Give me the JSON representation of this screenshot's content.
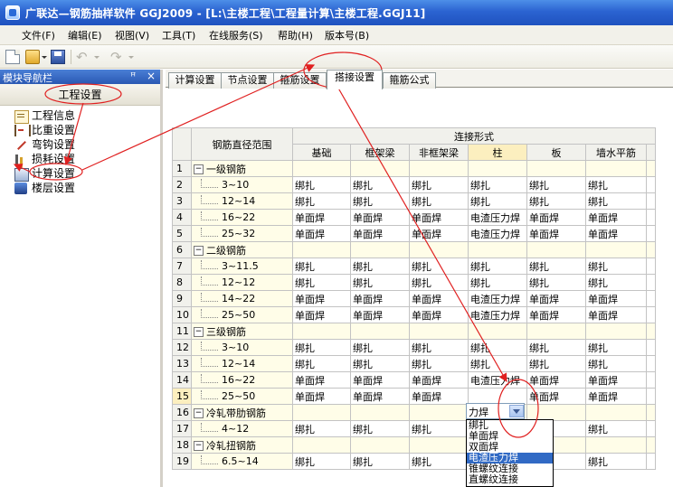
{
  "window": {
    "title": "广联达—钢筋抽样软件 GGJ2009 - [L:\\主楼工程\\工程量计算\\主楼工程.GGJ11]"
  },
  "menu": [
    {
      "label": "文件(F)"
    },
    {
      "label": "编辑(E)"
    },
    {
      "label": "视图(V)"
    },
    {
      "label": "工具(T)"
    },
    {
      "label": "在线服务(S)"
    },
    {
      "label": "帮助(H)"
    },
    {
      "label": "版本号(B)"
    }
  ],
  "toolbar": {
    "undo_glyph": "↶",
    "redo_glyph": "↷",
    "icons": [
      "new-file-icon",
      "open-folder-icon",
      "save-icon",
      "undo-icon",
      "redo-icon"
    ]
  },
  "nav_panel": {
    "title": "模块导航栏",
    "pin_glyph": "ꟸ",
    "close_glyph": "×",
    "section_button": "工程设置",
    "items": [
      {
        "label": "工程信息",
        "icon": "info-icon"
      },
      {
        "label": "比重设置",
        "icon": "weight-icon"
      },
      {
        "label": "弯钩设置",
        "icon": "hook-icon"
      },
      {
        "label": "损耗设置",
        "icon": "loss-icon"
      },
      {
        "label": "计算设置",
        "icon": "calc-icon"
      },
      {
        "label": "楼层设置",
        "icon": "floor-icon"
      }
    ]
  },
  "tabs": [
    {
      "label": "计算设置"
    },
    {
      "label": "节点设置"
    },
    {
      "label": "箍筋设置"
    },
    {
      "label": "搭接设置",
      "active": true
    },
    {
      "label": "箍筋公式"
    }
  ],
  "grid": {
    "range_header": "钢筋直径范围",
    "connection_header": "连接形式",
    "columns": [
      "基础",
      "框架梁",
      "非框架梁",
      "柱",
      "板",
      "墙水平筋"
    ],
    "rows": [
      {
        "num": "1",
        "group": true,
        "name": "一级钢筋",
        "cells": [
          "",
          "",
          "",
          "",
          "",
          ""
        ]
      },
      {
        "num": "2",
        "name": "3~10",
        "cells": [
          "绑扎",
          "绑扎",
          "绑扎",
          "绑扎",
          "绑扎",
          "绑扎"
        ]
      },
      {
        "num": "3",
        "name": "12~14",
        "cells": [
          "绑扎",
          "绑扎",
          "绑扎",
          "绑扎",
          "绑扎",
          "绑扎"
        ]
      },
      {
        "num": "4",
        "name": "16~22",
        "cells": [
          "单面焊",
          "单面焊",
          "单面焊",
          "电渣压力焊",
          "单面焊",
          "单面焊"
        ]
      },
      {
        "num": "5",
        "name": "25~32",
        "cells": [
          "单面焊",
          "单面焊",
          "单面焊",
          "电渣压力焊",
          "单面焊",
          "单面焊"
        ]
      },
      {
        "num": "6",
        "group": true,
        "name": "二级钢筋",
        "cells": [
          "",
          "",
          "",
          "",
          "",
          ""
        ]
      },
      {
        "num": "7",
        "name": "3~11.5",
        "cells": [
          "绑扎",
          "绑扎",
          "绑扎",
          "绑扎",
          "绑扎",
          "绑扎"
        ]
      },
      {
        "num": "8",
        "name": "12~12",
        "cells": [
          "绑扎",
          "绑扎",
          "绑扎",
          "绑扎",
          "绑扎",
          "绑扎"
        ]
      },
      {
        "num": "9",
        "name": "14~22",
        "cells": [
          "单面焊",
          "单面焊",
          "单面焊",
          "电渣压力焊",
          "单面焊",
          "单面焊"
        ]
      },
      {
        "num": "10",
        "name": "25~50",
        "cells": [
          "单面焊",
          "单面焊",
          "单面焊",
          "电渣压力焊",
          "单面焊",
          "单面焊"
        ]
      },
      {
        "num": "11",
        "group": true,
        "name": "三级钢筋",
        "cells": [
          "",
          "",
          "",
          "",
          "",
          ""
        ]
      },
      {
        "num": "12",
        "name": "3~10",
        "cells": [
          "绑扎",
          "绑扎",
          "绑扎",
          "绑扎",
          "绑扎",
          "绑扎"
        ]
      },
      {
        "num": "13",
        "name": "12~14",
        "cells": [
          "绑扎",
          "绑扎",
          "绑扎",
          "绑扎",
          "绑扎",
          "绑扎"
        ]
      },
      {
        "num": "14",
        "name": "16~22",
        "cells": [
          "单面焊",
          "单面焊",
          "单面焊",
          "电渣压力焊",
          "单面焊",
          "单面焊"
        ]
      },
      {
        "num": "15",
        "name": "25~50",
        "selected": true,
        "cells": [
          "单面焊",
          "单面焊",
          "单面焊",
          "",
          "单面焊",
          "单面焊"
        ]
      },
      {
        "num": "16",
        "group": true,
        "name": "冷轧带肋钢筋",
        "cells": [
          "",
          "",
          "",
          "",
          "",
          ""
        ]
      },
      {
        "num": "17",
        "name": "4~12",
        "cells": [
          "绑扎",
          "绑扎",
          "绑扎",
          "",
          "",
          "绑扎"
        ]
      },
      {
        "num": "18",
        "group": true,
        "name": "冷轧扭钢筋",
        "cells": [
          "",
          "",
          "",
          "",
          "",
          ""
        ]
      },
      {
        "num": "19",
        "name": "6.5~14",
        "cells": [
          "绑扎",
          "绑扎",
          "绑扎",
          "",
          "",
          "绑扎"
        ]
      }
    ]
  },
  "dropdown": {
    "value": "力焊",
    "options": [
      "绑扎",
      "单面焊",
      "双面焊",
      "电渣压力焊",
      "锥螺纹连接",
      "直螺纹连接"
    ],
    "highlighted_index": 3
  },
  "annotation_color": "#e02020"
}
